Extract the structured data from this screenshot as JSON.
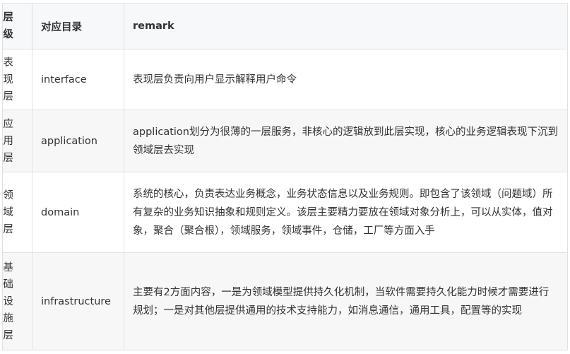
{
  "table": {
    "headers": {
      "layer": "层级",
      "directory": "对应目录",
      "remark": "remark"
    },
    "rows": [
      {
        "layer": "表现层",
        "directory": "interface",
        "remark": "表现层负责向用户显示解释用户命令"
      },
      {
        "layer": "应用层",
        "directory": "application",
        "remark": "application划分为很薄的一层服务，非核心的逻辑放到此层实现，核心的业务逻辑表现下沉到领域层去实现"
      },
      {
        "layer": "领域层",
        "directory": "domain",
        "remark": "系统的核心，负责表达业务概念，业务状态信息以及业务规则。即包含了该领域（问题域）所有复杂的业务知识抽象和规则定义。该层主要精力要放在领域对象分析上，可以从实体，值对象，聚合（聚合根），领域服务，领域事件，仓储，工厂等方面入手"
      },
      {
        "layer": "基础设施层",
        "directory": "infrastructure",
        "remark": "主要有2方面内容，一是为领域模型提供持久化机制，当软件需要持久化能力时候才需要进行规划；一是对其他层提供通用的技术支持能力，如消息通信，通用工具，配置等的实现"
      }
    ]
  }
}
